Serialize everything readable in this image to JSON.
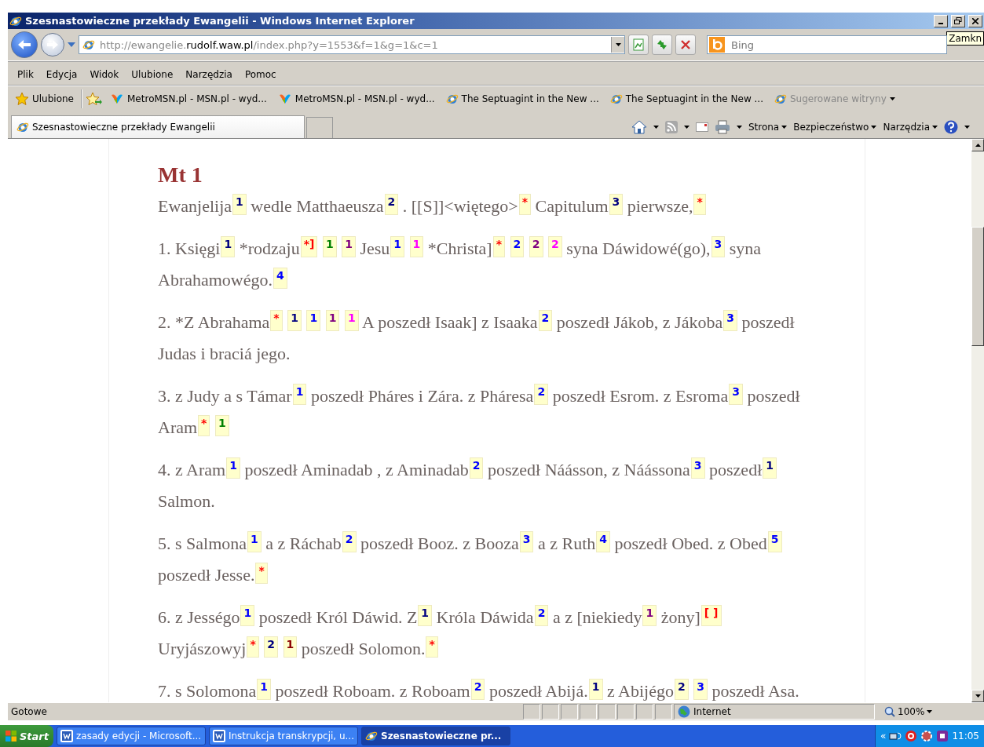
{
  "window": {
    "title": "Szesnastowieczne przekłady Ewangelii - Windows Internet Explorer",
    "tooltip": "Zamkn"
  },
  "address_bar": {
    "prefix": "http://ewangelie.",
    "domain": "rudolf.waw.pl",
    "suffix": "/index.php?y=1553&f=1&g=1&c=1"
  },
  "search": {
    "placeholder": "Bing"
  },
  "menu": [
    "Plik",
    "Edycja",
    "Widok",
    "Ulubione",
    "Narzędzia",
    "Pomoc"
  ],
  "favorites": {
    "label": "Ulubione",
    "links": [
      {
        "kind": "msn",
        "label": "MetroMSN.pl - MSN.pl - wyd..."
      },
      {
        "kind": "msn",
        "label": "MetroMSN.pl - MSN.pl - wyd..."
      },
      {
        "kind": "page",
        "label": "The Septuagint in the New ..."
      },
      {
        "kind": "page",
        "label": "The Septuagint in the New ..."
      }
    ],
    "suggested": "Sugerowane witryny"
  },
  "tabs": [
    {
      "label": "Szesnastowieczne przekłady Ewangelii",
      "selected": true
    }
  ],
  "command_bar": [
    "Strona",
    "Bezpieczeństwo",
    "Narzędzia"
  ],
  "content": {
    "heading": "Mt 1",
    "verses": [
      {
        "parts": [
          {
            "kind": "text",
            "text": "Ewanjelija"
          },
          {
            "kind": "note",
            "text": "1",
            "color": "#000080"
          },
          {
            "kind": "text",
            "text": "wedle Matthaeusza"
          },
          {
            "kind": "note",
            "text": "2",
            "color": "#000080"
          },
          {
            "kind": "text",
            "text": ". [[S]]<więtego>"
          },
          {
            "kind": "note",
            "text": "*",
            "color": "#ff0000"
          },
          {
            "kind": "text",
            "text": "Capitulum"
          },
          {
            "kind": "note",
            "text": "3",
            "color": "#000080"
          },
          {
            "kind": "text",
            "text": "pierwsze,"
          },
          {
            "kind": "note",
            "text": "*",
            "color": "#ff0000"
          }
        ]
      },
      {
        "parts": [
          {
            "kind": "text",
            "text": "1. Księgi"
          },
          {
            "kind": "note",
            "text": "1",
            "color": "#000080"
          },
          {
            "kind": "text",
            "text": "*rodzaju"
          },
          {
            "kind": "note",
            "text": "*]",
            "color": "#ff0000"
          },
          {
            "kind": "note",
            "text": "1",
            "color": "#008000"
          },
          {
            "kind": "note",
            "text": "1",
            "color": "#800080"
          },
          {
            "kind": "text",
            "text": "Jesu"
          },
          {
            "kind": "note",
            "text": "1",
            "color": "#0000ff"
          },
          {
            "kind": "note",
            "text": "1",
            "color": "#ff00ff"
          },
          {
            "kind": "text",
            "text": "*Christa]"
          },
          {
            "kind": "note",
            "text": "*",
            "color": "#ff0000"
          },
          {
            "kind": "note",
            "text": "2",
            "color": "#0000ff"
          },
          {
            "kind": "note",
            "text": "2",
            "color": "#800080"
          },
          {
            "kind": "note",
            "text": "2",
            "color": "#ff00ff"
          },
          {
            "kind": "text",
            "text": "syna Dáwidowé(go),"
          },
          {
            "kind": "note",
            "text": "3",
            "color": "#0000ff"
          },
          {
            "kind": "text",
            "text": "syna"
          },
          {
            "kind": "text",
            "text": "Abrahamowégo."
          },
          {
            "kind": "note",
            "text": "4",
            "color": "#0000ff"
          }
        ]
      },
      {
        "parts": [
          {
            "kind": "text",
            "text": "2. *Z Abrahama"
          },
          {
            "kind": "note",
            "text": "*",
            "color": "#ff0000"
          },
          {
            "kind": "note",
            "text": "1",
            "color": "#000080"
          },
          {
            "kind": "note",
            "text": "1",
            "color": "#0000ff"
          },
          {
            "kind": "note",
            "text": "1",
            "color": "#800080"
          },
          {
            "kind": "note",
            "text": "1",
            "color": "#ff00ff"
          },
          {
            "kind": "text",
            "text": "A poszedł Isaak] z Isaaka"
          },
          {
            "kind": "note",
            "text": "2",
            "color": "#0000ff"
          },
          {
            "kind": "text",
            "text": "poszedł Jákob, z Jákoba"
          },
          {
            "kind": "note",
            "text": "3",
            "color": "#0000ff"
          },
          {
            "kind": "text",
            "text": "poszedł"
          },
          {
            "kind": "text",
            "text": "Judas i braciá jego."
          }
        ]
      },
      {
        "parts": [
          {
            "kind": "text",
            "text": "3. z Judy a s Támar"
          },
          {
            "kind": "note",
            "text": "1",
            "color": "#0000ff"
          },
          {
            "kind": "text",
            "text": "poszedł Pháres i Zára. z Pháresa"
          },
          {
            "kind": "note",
            "text": "2",
            "color": "#0000ff"
          },
          {
            "kind": "text",
            "text": "poszedł Esrom. z Esroma"
          },
          {
            "kind": "note",
            "text": "3",
            "color": "#0000ff"
          },
          {
            "kind": "text",
            "text": "poszedł"
          },
          {
            "kind": "text",
            "text": "Aram"
          },
          {
            "kind": "note",
            "text": "*",
            "color": "#ff0000"
          },
          {
            "kind": "note",
            "text": "1",
            "color": "#008000"
          }
        ]
      },
      {
        "parts": [
          {
            "kind": "text",
            "text": "4. z Aram"
          },
          {
            "kind": "note",
            "text": "1",
            "color": "#0000ff"
          },
          {
            "kind": "text",
            "text": "poszedł Aminadab , z Aminadab"
          },
          {
            "kind": "note",
            "text": "2",
            "color": "#0000ff"
          },
          {
            "kind": "text",
            "text": "poszedł Náásson, z Náássona"
          },
          {
            "kind": "note",
            "text": "3",
            "color": "#0000ff"
          },
          {
            "kind": "text",
            "text": "poszedł"
          },
          {
            "kind": "note",
            "text": "1",
            "color": "#000080"
          },
          {
            "kind": "text",
            "text": "Salmon."
          }
        ]
      },
      {
        "parts": [
          {
            "kind": "text",
            "text": "5. s Salmona"
          },
          {
            "kind": "note",
            "text": "1",
            "color": "#0000ff"
          },
          {
            "kind": "text",
            "text": "a z Ráchab"
          },
          {
            "kind": "note",
            "text": "2",
            "color": "#0000ff"
          },
          {
            "kind": "text",
            "text": "poszedł Booz. z Booza"
          },
          {
            "kind": "note",
            "text": "3",
            "color": "#0000ff"
          },
          {
            "kind": "text",
            "text": "a z Ruth"
          },
          {
            "kind": "note",
            "text": "4",
            "color": "#0000ff"
          },
          {
            "kind": "text",
            "text": "poszedł Obed. z Obed"
          },
          {
            "kind": "note",
            "text": "5",
            "color": "#0000ff"
          },
          {
            "kind": "text",
            "text": "poszedł Jesse."
          },
          {
            "kind": "note",
            "text": "*",
            "color": "#ff0000"
          }
        ]
      },
      {
        "parts": [
          {
            "kind": "text",
            "text": "6. z Jességo"
          },
          {
            "kind": "note",
            "text": "1",
            "color": "#0000ff"
          },
          {
            "kind": "text",
            "text": "poszedł Król Dáwid. Z"
          },
          {
            "kind": "note",
            "text": "1",
            "color": "#000080"
          },
          {
            "kind": "text",
            "text": "Króla Dáwida"
          },
          {
            "kind": "note",
            "text": "2",
            "color": "#0000ff"
          },
          {
            "kind": "text",
            "text": "a z [niekiedy"
          },
          {
            "kind": "note",
            "text": "1",
            "color": "#800080"
          },
          {
            "kind": "text",
            "text": "żony]"
          },
          {
            "kind": "note",
            "text": "[ ]",
            "color": "#ff0000"
          },
          {
            "kind": "text",
            "text": "Uryjászowyj"
          },
          {
            "kind": "note",
            "text": "*",
            "color": "#ff0000"
          },
          {
            "kind": "note",
            "text": "2",
            "color": "#000080"
          },
          {
            "kind": "note",
            "text": "1",
            "color": "#8b0000"
          },
          {
            "kind": "text",
            "text": "poszedł Solomon."
          },
          {
            "kind": "note",
            "text": "*",
            "color": "#ff0000"
          }
        ]
      },
      {
        "parts": [
          {
            "kind": "text",
            "text": "7. s Solomona"
          },
          {
            "kind": "note",
            "text": "1",
            "color": "#0000ff"
          },
          {
            "kind": "text",
            "text": "poszedł Roboam. z Roboam"
          },
          {
            "kind": "note",
            "text": "2",
            "color": "#0000ff"
          },
          {
            "kind": "text",
            "text": "poszedł Abijá."
          },
          {
            "kind": "note",
            "text": "1",
            "color": "#000080"
          },
          {
            "kind": "text",
            "text": "z Abijégo"
          },
          {
            "kind": "note",
            "text": "2",
            "color": "#000080"
          },
          {
            "kind": "note",
            "text": "3",
            "color": "#0000ff"
          },
          {
            "kind": "text",
            "text": "poszedł Asa."
          }
        ]
      }
    ]
  },
  "status_bar": {
    "text": "Gotowe",
    "zone": "Internet",
    "zoom": "100%"
  },
  "taskbar": {
    "start": "Start",
    "items": [
      {
        "kind": "word",
        "label": "zasady edycji - Microsoft...",
        "selected": false
      },
      {
        "kind": "word",
        "label": "Instrukcja transkrypcji, u...",
        "selected": false
      },
      {
        "kind": "ie",
        "label": "Szesnastowieczne pr...",
        "selected": true
      }
    ],
    "tray_toggle": "«",
    "clock": "11:05"
  }
}
